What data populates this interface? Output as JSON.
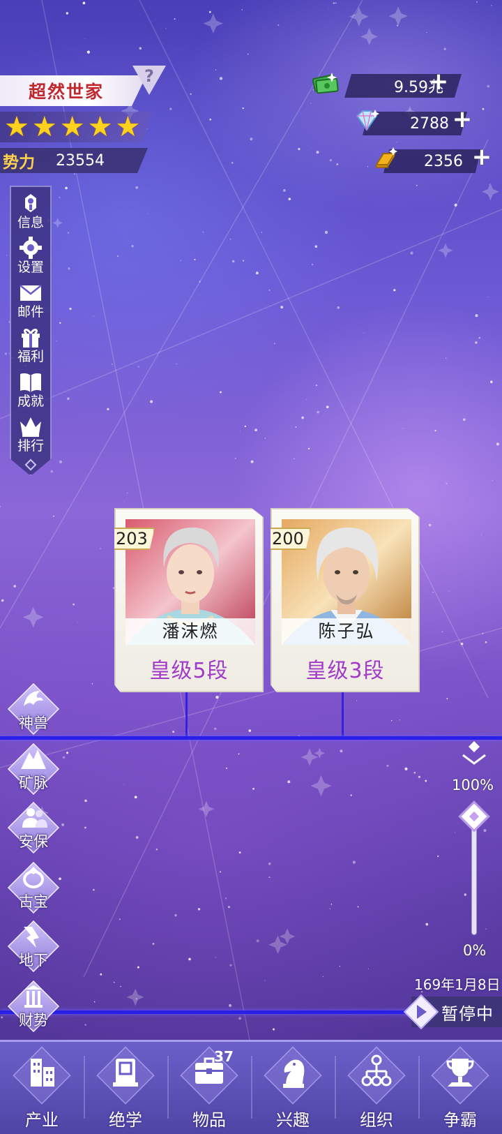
{
  "player": {
    "family_name": "超然世家",
    "help_symbol": "?",
    "stars": 5,
    "power_label": "势力",
    "power_value": "23554"
  },
  "currencies": {
    "cash": "9.59兆",
    "diamonds": "2788",
    "gold": "2356",
    "add_symbol": "+"
  },
  "side_menu": [
    {
      "id": "info",
      "label": "信息",
      "icon": "info-icon"
    },
    {
      "id": "settings",
      "label": "设置",
      "icon": "gear-icon"
    },
    {
      "id": "mail",
      "label": "邮件",
      "icon": "envelope-icon"
    },
    {
      "id": "welfare",
      "label": "福利",
      "icon": "gift-icon"
    },
    {
      "id": "achievement",
      "label": "成就",
      "icon": "book-icon"
    },
    {
      "id": "ranking",
      "label": "排行",
      "icon": "crown-icon"
    }
  ],
  "characters": [
    {
      "level": "203",
      "name": "潘沫燃",
      "rank": "皇级5段"
    },
    {
      "level": "200",
      "name": "陈子弘",
      "rank": "皇级3段"
    }
  ],
  "features": [
    {
      "id": "beast",
      "label": "神兽",
      "icon": "dragon-icon"
    },
    {
      "id": "mine",
      "label": "矿脉",
      "icon": "mountain-icon"
    },
    {
      "id": "security",
      "label": "安保",
      "icon": "people-icon"
    },
    {
      "id": "antique",
      "label": "古宝",
      "icon": "ring-icon"
    },
    {
      "id": "underground",
      "label": "地下",
      "icon": "crack-icon"
    },
    {
      "id": "wealth",
      "label": "财势",
      "icon": "pillar-icon"
    }
  ],
  "zoom": {
    "max_label": "100%",
    "min_label": "0%",
    "level": 0.95
  },
  "time": {
    "date": "169年1月8日",
    "pause_label": "暂停中"
  },
  "bottom_nav": [
    {
      "id": "industry",
      "label": "产业",
      "icon": "building-icon"
    },
    {
      "id": "skills",
      "label": "绝学",
      "icon": "scroll-icon"
    },
    {
      "id": "items",
      "label": "物品",
      "icon": "toolbox-icon",
      "badge": "37"
    },
    {
      "id": "hobby",
      "label": "兴趣",
      "icon": "chess-knight-icon"
    },
    {
      "id": "organization",
      "label": "组织",
      "icon": "org-chart-icon"
    },
    {
      "id": "compete",
      "label": "争霸",
      "icon": "trophy-icon"
    }
  ],
  "colors": {
    "family_name": "#c0282e",
    "power_label": "#ffd24a",
    "rank_text": "#a23ac9",
    "lineage_line": "#2a1fe8",
    "star": "#ffd21f"
  }
}
